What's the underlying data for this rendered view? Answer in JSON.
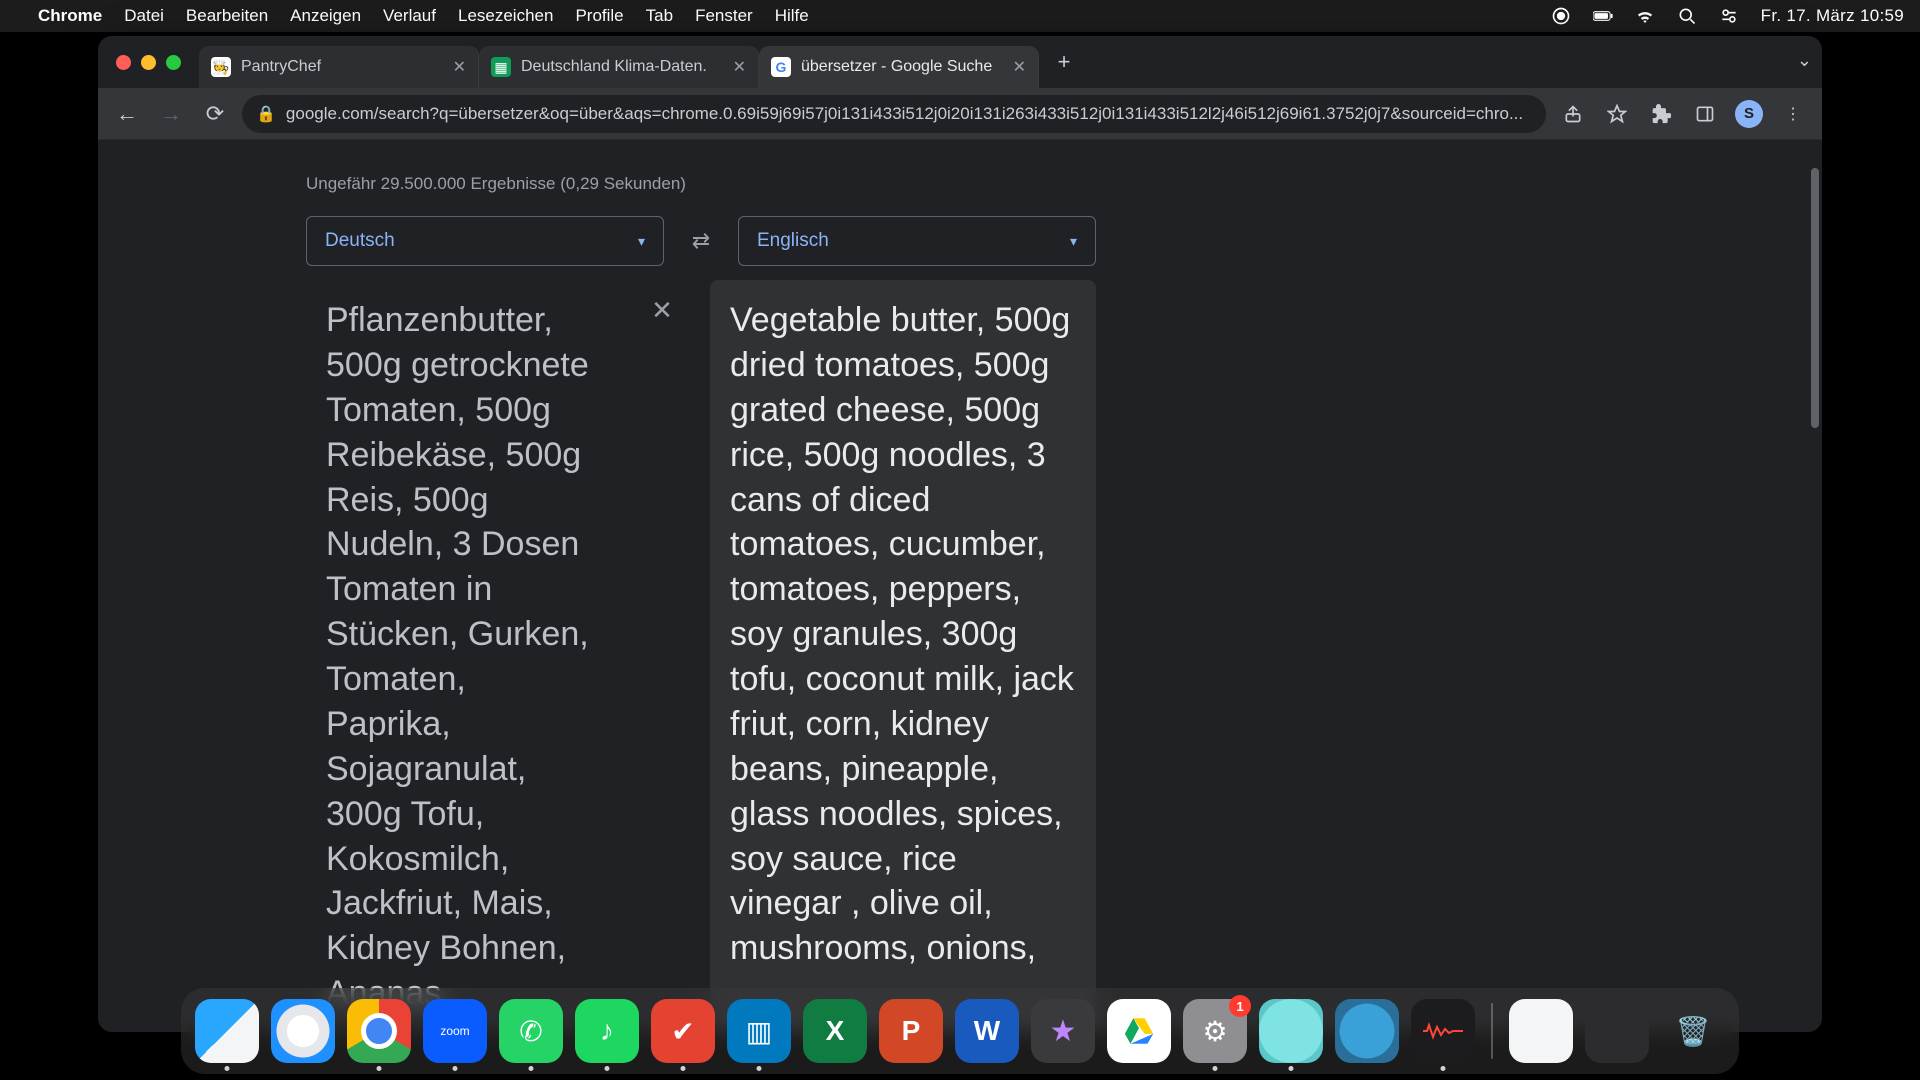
{
  "menubar": {
    "app": "Chrome",
    "items": [
      "Datei",
      "Bearbeiten",
      "Anzeigen",
      "Verlauf",
      "Lesezeichen",
      "Profile",
      "Tab",
      "Fenster",
      "Hilfe"
    ],
    "clock": "Fr. 17. März 10:59"
  },
  "browser": {
    "tabs": [
      {
        "title": "PantryChef",
        "active": false
      },
      {
        "title": "Deutschland Klima-Daten.",
        "active": false
      },
      {
        "title": "übersetzer - Google Suche",
        "active": true
      }
    ],
    "url": "google.com/search?q=übersetzer&oq=über&aqs=chrome.0.69i59j69i57j0i131i433i512j0i20i131i263i433i512j0i131i433i512l2j46i512j69i61.3752j0j7&sourceid=chro...",
    "avatar_initial": "S"
  },
  "page": {
    "results_meta": "Ungefähr 29.500.000 Ergebnisse (0,29 Sekunden)",
    "source_lang": "Deutsch",
    "target_lang": "Englisch",
    "source_text": "Pflanzenbutter, 500g getrocknete Tomaten, 500g Reibekäse, 500g Reis, 500g Nudeln, 3 Dosen Tomaten in Stücken, Gurken, Tomaten, Paprika, Sojagranulat, 300g Tofu, Kokosmilch, Jackfriut, Mais, Kidney Bohnen, Ananas,",
    "target_text": "Vegetable butter, 500g dried tomatoes, 500g grated cheese, 500g rice, 500g noodles, 3 cans of diced tomatoes, cucumber, tomatoes, peppers, soy granules, 300g tofu, coconut milk, jack friut, corn, kidney beans, pineapple, glass noodles, spices, soy sauce, rice vinegar , olive oil, mushrooms, onions,"
  },
  "dock": {
    "settings_badge": "1"
  }
}
